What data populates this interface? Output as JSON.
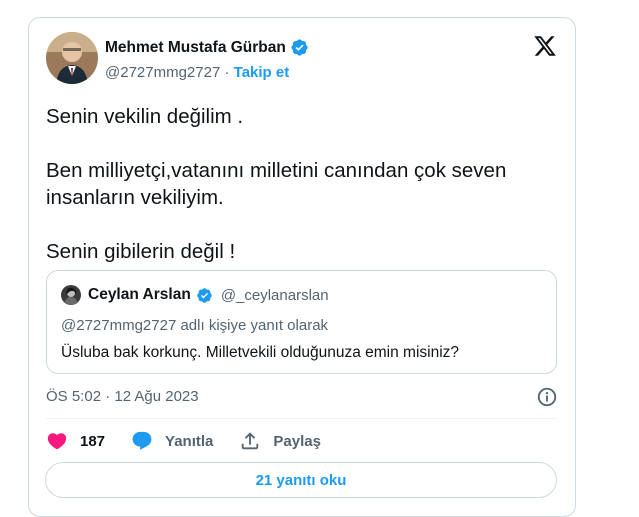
{
  "author": {
    "name": "Mehmet Mustafa Gürban",
    "handle": "@2727mmg2727",
    "separator": "·",
    "follow_label": "Takip et",
    "verified": true,
    "avatar_icon": "profile-photo"
  },
  "platform_logo": "x-logo",
  "tweet": {
    "lines": [
      "Senin vekilin değilim .",
      "Ben milliyetçi,vatanını milletini canından çok seven insanların vekiliyim.",
      "Senin gibilerin değil !"
    ]
  },
  "quote": {
    "name": "Ceylan Arslan",
    "handle": "@_ceylanarslan",
    "verified": true,
    "reply_context": "@2727mmg2727 adlı kişiye yanıt olarak",
    "text": "Üsluba bak korkunç. Milletvekili olduğunuza emin misiniz?"
  },
  "meta": {
    "timestamp": "ÖS 5:02 · 12 Ağu 2023"
  },
  "actions": {
    "like_count": "187",
    "reply_label": "Yanıtla",
    "share_label": "Paylaş"
  },
  "replies_button": "21 yanıtı oku",
  "colors": {
    "accent": "#1d9bf0",
    "like": "#f91880",
    "secondary_text": "#536471",
    "border": "#cfd9de"
  }
}
